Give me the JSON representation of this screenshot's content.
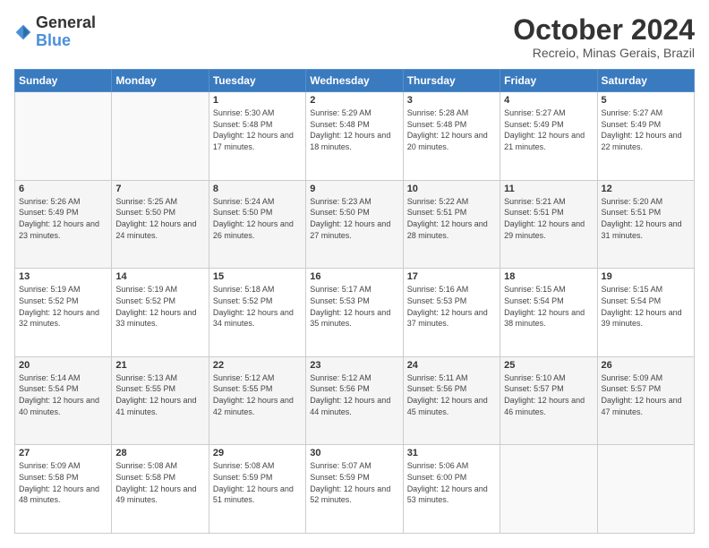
{
  "logo": {
    "general": "General",
    "blue": "Blue"
  },
  "header": {
    "month": "October 2024",
    "location": "Recreio, Minas Gerais, Brazil"
  },
  "weekdays": [
    "Sunday",
    "Monday",
    "Tuesday",
    "Wednesday",
    "Thursday",
    "Friday",
    "Saturday"
  ],
  "weeks": [
    [
      {
        "day": "",
        "info": ""
      },
      {
        "day": "",
        "info": ""
      },
      {
        "day": "1",
        "info": "Sunrise: 5:30 AM\nSunset: 5:48 PM\nDaylight: 12 hours and 17 minutes."
      },
      {
        "day": "2",
        "info": "Sunrise: 5:29 AM\nSunset: 5:48 PM\nDaylight: 12 hours and 18 minutes."
      },
      {
        "day": "3",
        "info": "Sunrise: 5:28 AM\nSunset: 5:48 PM\nDaylight: 12 hours and 20 minutes."
      },
      {
        "day": "4",
        "info": "Sunrise: 5:27 AM\nSunset: 5:49 PM\nDaylight: 12 hours and 21 minutes."
      },
      {
        "day": "5",
        "info": "Sunrise: 5:27 AM\nSunset: 5:49 PM\nDaylight: 12 hours and 22 minutes."
      }
    ],
    [
      {
        "day": "6",
        "info": "Sunrise: 5:26 AM\nSunset: 5:49 PM\nDaylight: 12 hours and 23 minutes."
      },
      {
        "day": "7",
        "info": "Sunrise: 5:25 AM\nSunset: 5:50 PM\nDaylight: 12 hours and 24 minutes."
      },
      {
        "day": "8",
        "info": "Sunrise: 5:24 AM\nSunset: 5:50 PM\nDaylight: 12 hours and 26 minutes."
      },
      {
        "day": "9",
        "info": "Sunrise: 5:23 AM\nSunset: 5:50 PM\nDaylight: 12 hours and 27 minutes."
      },
      {
        "day": "10",
        "info": "Sunrise: 5:22 AM\nSunset: 5:51 PM\nDaylight: 12 hours and 28 minutes."
      },
      {
        "day": "11",
        "info": "Sunrise: 5:21 AM\nSunset: 5:51 PM\nDaylight: 12 hours and 29 minutes."
      },
      {
        "day": "12",
        "info": "Sunrise: 5:20 AM\nSunset: 5:51 PM\nDaylight: 12 hours and 31 minutes."
      }
    ],
    [
      {
        "day": "13",
        "info": "Sunrise: 5:19 AM\nSunset: 5:52 PM\nDaylight: 12 hours and 32 minutes."
      },
      {
        "day": "14",
        "info": "Sunrise: 5:19 AM\nSunset: 5:52 PM\nDaylight: 12 hours and 33 minutes."
      },
      {
        "day": "15",
        "info": "Sunrise: 5:18 AM\nSunset: 5:52 PM\nDaylight: 12 hours and 34 minutes."
      },
      {
        "day": "16",
        "info": "Sunrise: 5:17 AM\nSunset: 5:53 PM\nDaylight: 12 hours and 35 minutes."
      },
      {
        "day": "17",
        "info": "Sunrise: 5:16 AM\nSunset: 5:53 PM\nDaylight: 12 hours and 37 minutes."
      },
      {
        "day": "18",
        "info": "Sunrise: 5:15 AM\nSunset: 5:54 PM\nDaylight: 12 hours and 38 minutes."
      },
      {
        "day": "19",
        "info": "Sunrise: 5:15 AM\nSunset: 5:54 PM\nDaylight: 12 hours and 39 minutes."
      }
    ],
    [
      {
        "day": "20",
        "info": "Sunrise: 5:14 AM\nSunset: 5:54 PM\nDaylight: 12 hours and 40 minutes."
      },
      {
        "day": "21",
        "info": "Sunrise: 5:13 AM\nSunset: 5:55 PM\nDaylight: 12 hours and 41 minutes."
      },
      {
        "day": "22",
        "info": "Sunrise: 5:12 AM\nSunset: 5:55 PM\nDaylight: 12 hours and 42 minutes."
      },
      {
        "day": "23",
        "info": "Sunrise: 5:12 AM\nSunset: 5:56 PM\nDaylight: 12 hours and 44 minutes."
      },
      {
        "day": "24",
        "info": "Sunrise: 5:11 AM\nSunset: 5:56 PM\nDaylight: 12 hours and 45 minutes."
      },
      {
        "day": "25",
        "info": "Sunrise: 5:10 AM\nSunset: 5:57 PM\nDaylight: 12 hours and 46 minutes."
      },
      {
        "day": "26",
        "info": "Sunrise: 5:09 AM\nSunset: 5:57 PM\nDaylight: 12 hours and 47 minutes."
      }
    ],
    [
      {
        "day": "27",
        "info": "Sunrise: 5:09 AM\nSunset: 5:58 PM\nDaylight: 12 hours and 48 minutes."
      },
      {
        "day": "28",
        "info": "Sunrise: 5:08 AM\nSunset: 5:58 PM\nDaylight: 12 hours and 49 minutes."
      },
      {
        "day": "29",
        "info": "Sunrise: 5:08 AM\nSunset: 5:59 PM\nDaylight: 12 hours and 51 minutes."
      },
      {
        "day": "30",
        "info": "Sunrise: 5:07 AM\nSunset: 5:59 PM\nDaylight: 12 hours and 52 minutes."
      },
      {
        "day": "31",
        "info": "Sunrise: 5:06 AM\nSunset: 6:00 PM\nDaylight: 12 hours and 53 minutes."
      },
      {
        "day": "",
        "info": ""
      },
      {
        "day": "",
        "info": ""
      }
    ]
  ]
}
